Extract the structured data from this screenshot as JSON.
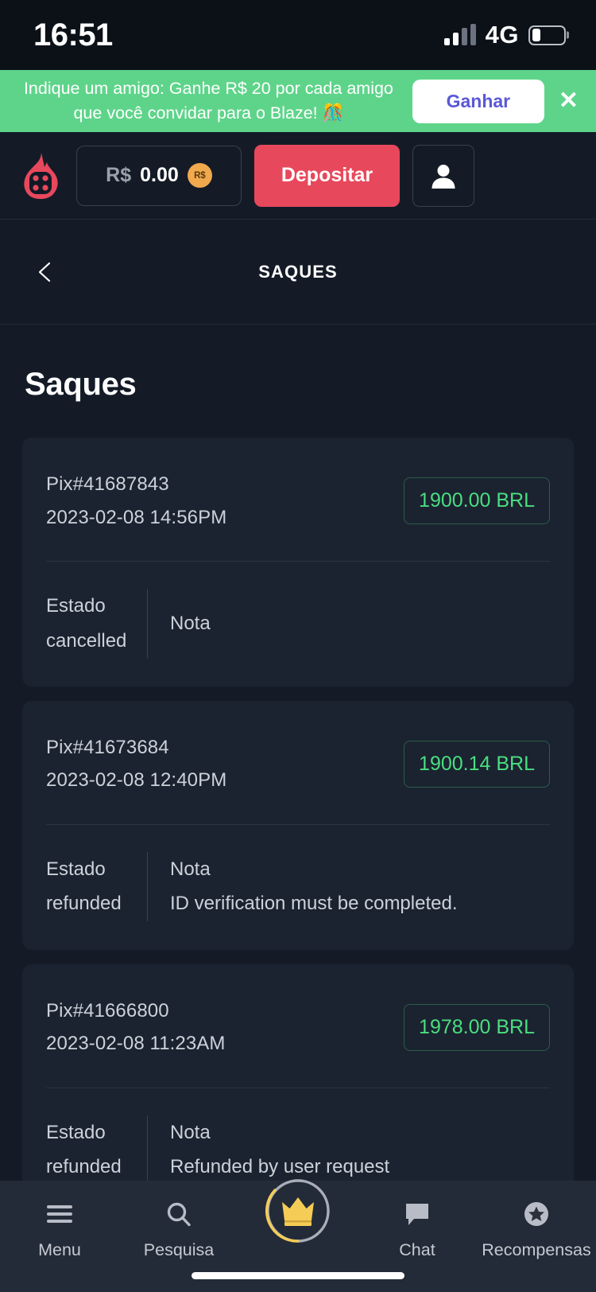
{
  "status_bar": {
    "time": "16:51",
    "network": "4G",
    "signal_icon": "signal-bars-icon",
    "battery_icon": "battery-icon",
    "battery_level_percent": 28
  },
  "promo_banner": {
    "message": "Indique um amigo: Ganhe R$ 20 por cada amigo que você convidar para o Blaze! 🎊",
    "button_label": "Ganhar",
    "close_label": "✕",
    "background_color": "#5ed48a",
    "button_text_color": "#5a58d6"
  },
  "app_header": {
    "logo_icon": "blaze-flame-logo",
    "balance_currency": "R$",
    "balance_value": "0.00",
    "coin_badge_label": "R$",
    "deposit_label": "Depositar",
    "deposit_color": "#e8485c",
    "account_icon": "user-avatar-icon"
  },
  "sub_nav": {
    "back_icon": "chevron-left-icon",
    "title": "SAQUES"
  },
  "main": {
    "page_title": "Saques",
    "labels": {
      "estado": "Estado",
      "nota": "Nota"
    },
    "transactions": [
      {
        "id": "Pix#41687843",
        "date": "2023-02-08 14:56PM",
        "amount": "1900.00 BRL",
        "estado": "cancelled",
        "nota": ""
      },
      {
        "id": "Pix#41673684",
        "date": "2023-02-08 12:40PM",
        "amount": "1900.14 BRL",
        "estado": "refunded",
        "nota": "ID verification must be completed."
      },
      {
        "id": "Pix#41666800",
        "date": "2023-02-08 11:23AM",
        "amount": "1978.00 BRL",
        "estado": "refunded",
        "nota": "Refunded by user request"
      }
    ],
    "amount_color": "#4ade80"
  },
  "tabbar": {
    "items": [
      {
        "label": "Menu",
        "icon": "hamburger-menu-icon"
      },
      {
        "label": "Pesquisa",
        "icon": "search-icon"
      },
      {
        "label": "",
        "icon": "crown-icon"
      },
      {
        "label": "Chat",
        "icon": "chat-bubble-icon"
      },
      {
        "label": "Recompensas",
        "icon": "star-badge-icon"
      }
    ],
    "crown_color": "#f5cd56"
  }
}
